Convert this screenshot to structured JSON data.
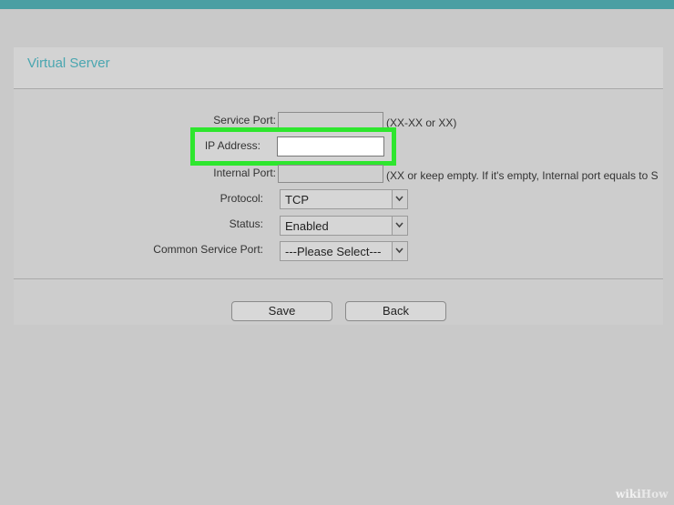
{
  "page": {
    "title": "Virtual Server"
  },
  "form": {
    "service_port": {
      "label": "Service Port:",
      "value": "",
      "hint": "(XX-XX or XX)"
    },
    "ip_address": {
      "label": "IP Address:",
      "value": ""
    },
    "internal_port": {
      "label": "Internal Port:",
      "value": "",
      "hint": "(XX or keep empty. If it's empty, Internal port equals to S"
    },
    "protocol": {
      "label": "Protocol:",
      "value": "TCP"
    },
    "status": {
      "label": "Status:",
      "value": "Enabled"
    },
    "common_service_port": {
      "label": "Common Service Port:",
      "value": "---Please Select---"
    }
  },
  "buttons": {
    "save": "Save",
    "back": "Back"
  },
  "watermark": {
    "wiki": "wiki",
    "how": "How"
  },
  "colors": {
    "top_bar": "#4a9fa3",
    "title": "#4aa6b0",
    "highlight": "#2ee62e"
  },
  "icons": {
    "select_arrow": "chevron-down-icon"
  }
}
